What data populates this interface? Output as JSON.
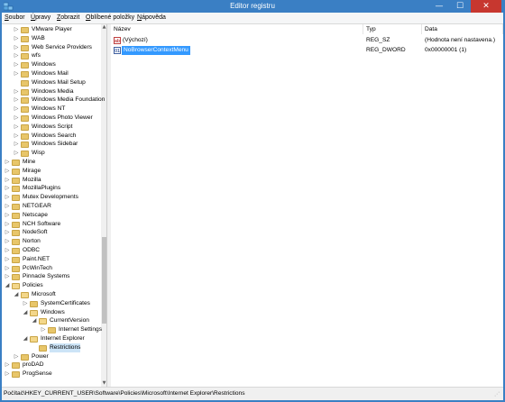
{
  "window": {
    "title": "Editor registru",
    "minimize_glyph": "—",
    "maximize_glyph": "☐",
    "close_glyph": "✕"
  },
  "menu": [
    {
      "label": "Soubor",
      "key": "S",
      "rest": "oubor"
    },
    {
      "label": "Úpravy",
      "key": "Ú",
      "rest": "pravy"
    },
    {
      "label": "Zobrazit",
      "key": "Z",
      "rest": "obrazit"
    },
    {
      "label": "Oblíbené položky",
      "key": "O",
      "rest": "blíbené položky"
    },
    {
      "label": "Nápověda",
      "key": "N",
      "rest": "ápověda"
    }
  ],
  "tree": {
    "items": [
      {
        "label": "VMware Player",
        "expander": "▷"
      },
      {
        "label": "WAB",
        "expander": "▷"
      },
      {
        "label": "Web Service Providers",
        "expander": "▷"
      },
      {
        "label": "wfs",
        "expander": "▷"
      },
      {
        "label": "Windows",
        "expander": "▷"
      },
      {
        "label": "Windows Mail",
        "expander": "▷"
      },
      {
        "label": "Windows Mail Setup",
        "expander": ""
      },
      {
        "label": "Windows Media",
        "expander": "▷"
      },
      {
        "label": "Windows Media Foundation",
        "expander": "▷"
      },
      {
        "label": "Windows NT",
        "expander": "▷"
      },
      {
        "label": "Windows Photo Viewer",
        "expander": "▷"
      },
      {
        "label": "Windows Script",
        "expander": "▷"
      },
      {
        "label": "Windows Search",
        "expander": "▷"
      },
      {
        "label": "Windows Sidebar",
        "expander": "▷"
      },
      {
        "label": "Wisp",
        "expander": "▷"
      },
      {
        "label": "Mine",
        "expander": "▷"
      },
      {
        "label": "Mirage",
        "expander": "▷"
      },
      {
        "label": "Mozilla",
        "expander": "▷"
      },
      {
        "label": "MozillaPlugins",
        "expander": "▷"
      },
      {
        "label": "Mutex Developments",
        "expander": "▷"
      },
      {
        "label": "NETGEAR",
        "expander": "▷"
      },
      {
        "label": "Netscape",
        "expander": "▷"
      },
      {
        "label": "NCH Software",
        "expander": "▷"
      },
      {
        "label": "NodeSoft",
        "expander": "▷"
      },
      {
        "label": "Norton",
        "expander": "▷"
      },
      {
        "label": "ODBC",
        "expander": "▷"
      },
      {
        "label": "Paint.NET",
        "expander": "▷"
      },
      {
        "label": "PcWinTech",
        "expander": "▷"
      },
      {
        "label": "Pinnacle Systems",
        "expander": "▷"
      },
      {
        "label": "Policies",
        "expander": "◢"
      },
      {
        "label": "Microsoft",
        "expander": "◢"
      },
      {
        "label": "SystemCertificates",
        "expander": "▷"
      },
      {
        "label": "Windows",
        "expander": "◢"
      },
      {
        "label": "CurrentVersion",
        "expander": "◢"
      },
      {
        "label": "Internet Settings",
        "expander": "▷"
      },
      {
        "label": "Internet Explorer",
        "expander": "◢"
      },
      {
        "label": "Restrictions",
        "expander": ""
      },
      {
        "label": "Power",
        "expander": "▷"
      },
      {
        "label": "proDAD",
        "expander": "▷"
      },
      {
        "label": "ProgSense",
        "expander": "▷"
      }
    ]
  },
  "list": {
    "columns": [
      "Název",
      "Typ",
      "Data"
    ],
    "rows": [
      {
        "name": "(Výchozí)",
        "type": "REG_SZ",
        "data": "(Hodnota není nastavena.)",
        "icon": "ab",
        "icon_text": "ab"
      },
      {
        "name": "NoBrowserContextMenu",
        "type": "REG_DWORD",
        "data": "0x00000001 (1)",
        "icon": "bin",
        "icon_text": "01"
      }
    ]
  },
  "status": {
    "path": "Počítač\\HKEY_CURRENT_USER\\Software\\Policies\\Microsoft\\Internet Explorer\\Restrictions"
  },
  "colors": {
    "titlebar": "#3a7fc4",
    "close": "#c7372f",
    "selection": "#3399ff",
    "folder": "#e8c66a"
  }
}
